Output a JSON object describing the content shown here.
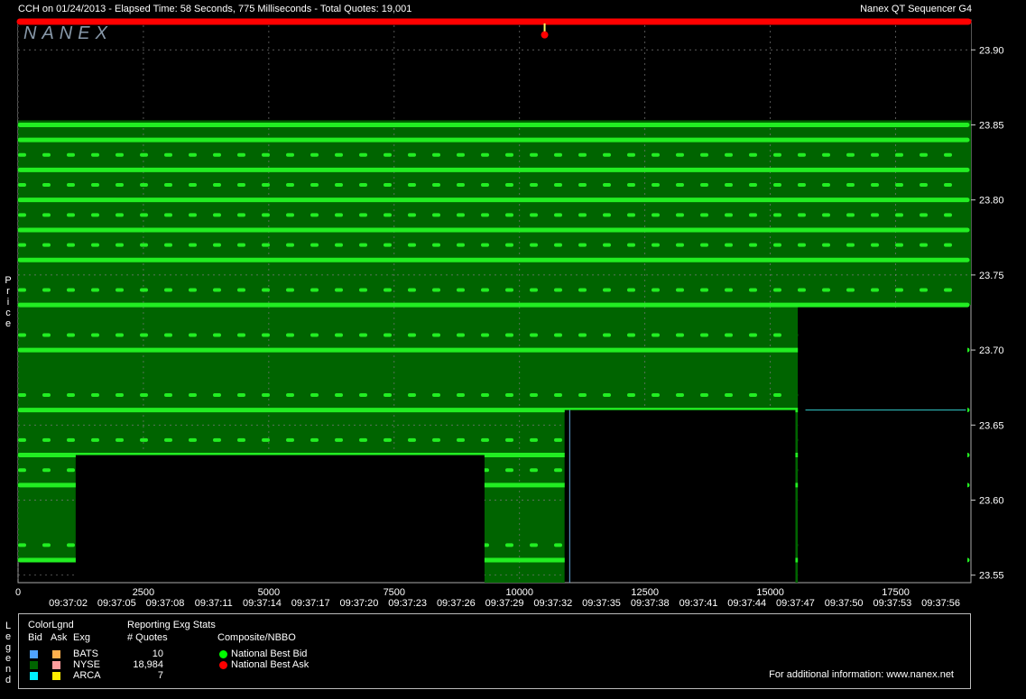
{
  "header": {
    "left": "CCH on 01/24/2013  -  Elapsed Time: 58 Seconds, 775 Milliseconds  -  Total Quotes: 19,001",
    "right": "Nanex QT Sequencer G4",
    "watermark": "NANEX"
  },
  "side_labels": {
    "price": [
      "P",
      "r",
      "i",
      "c",
      "e"
    ],
    "legend": [
      "L",
      "e",
      "g",
      "e",
      "n",
      "d"
    ]
  },
  "chart_data": {
    "type": "line",
    "ylim": [
      23.545,
      23.92
    ],
    "xlim": [
      0,
      19001
    ],
    "y_ticks": [
      "23.90",
      "23.85",
      "23.80",
      "23.75",
      "23.70",
      "23.65",
      "23.60",
      "23.55"
    ],
    "y_tick_values": [
      23.9,
      23.85,
      23.8,
      23.75,
      23.7,
      23.65,
      23.6,
      23.55
    ],
    "x_ticks": [
      "0",
      "2500",
      "5000",
      "7500",
      "10000",
      "12500",
      "15000",
      "17500"
    ],
    "x_tick_values": [
      0,
      2500,
      5000,
      7500,
      10000,
      12500,
      15000,
      17500
    ],
    "time_ticks": [
      "09:37:02",
      "09:37:05",
      "09:37:08",
      "09:37:11",
      "09:37:14",
      "09:37:17",
      "09:37:20",
      "09:37:23",
      "09:37:26",
      "09:37:29",
      "09:37:32",
      "09:37:35",
      "09:37:38",
      "09:37:41",
      "09:37:44",
      "09:37:47",
      "09:37:50",
      "09:37:53",
      "09:37:56"
    ],
    "national_best_ask": [
      [
        0,
        23.92
      ],
      [
        19001,
        23.92
      ]
    ],
    "ask_spike": {
      "x": 10500,
      "low": 23.91
    },
    "national_best_bid": [
      [
        0,
        23.56
      ],
      [
        1150,
        23.56
      ],
      [
        1150,
        23.63
      ],
      [
        9300,
        23.63
      ],
      [
        9300,
        23.545
      ],
      [
        10900,
        23.545
      ],
      [
        10900,
        23.66
      ],
      [
        15500,
        23.66
      ],
      [
        15500,
        23.545
      ],
      [
        15550,
        23.545
      ],
      [
        15550,
        23.73
      ],
      [
        19001,
        23.73
      ]
    ],
    "quote_levels": [
      23.85,
      23.84,
      23.83,
      23.82,
      23.81,
      23.8,
      23.79,
      23.78,
      23.77,
      23.76,
      23.74,
      23.73,
      23.71,
      23.7,
      23.67,
      23.66,
      23.64,
      23.63,
      23.62,
      23.61,
      23.57,
      23.56
    ],
    "cyan_line": {
      "x": [
        15700,
        18900
      ],
      "y": 23.66,
      "vx": 11000
    }
  },
  "legend": {
    "color_title": "ColorLgnd",
    "bid": "Bid",
    "ask": "Ask",
    "exg": "Exg",
    "stats_title": "Reporting Exg Stats",
    "quotes_header": "# Quotes",
    "composite_title": "Composite/NBBO",
    "exchanges": [
      {
        "name": "BATS",
        "quotes": "10",
        "bid_color": "#4fa3ff",
        "ask_color": "#ffb04d"
      },
      {
        "name": "NYSE",
        "quotes": "18,984",
        "bid_color": "#006400",
        "ask_color": "#ff9e9e"
      },
      {
        "name": "ARCA",
        "quotes": "7",
        "bid_color": "#00f0ff",
        "ask_color": "#ffee00"
      }
    ],
    "nbbo": [
      {
        "label": "National Best Bid",
        "color": "#00ff00"
      },
      {
        "label": "National Best Ask",
        "color": "#ff0000"
      }
    ],
    "footer": "For additional information: www.nanex.net"
  }
}
